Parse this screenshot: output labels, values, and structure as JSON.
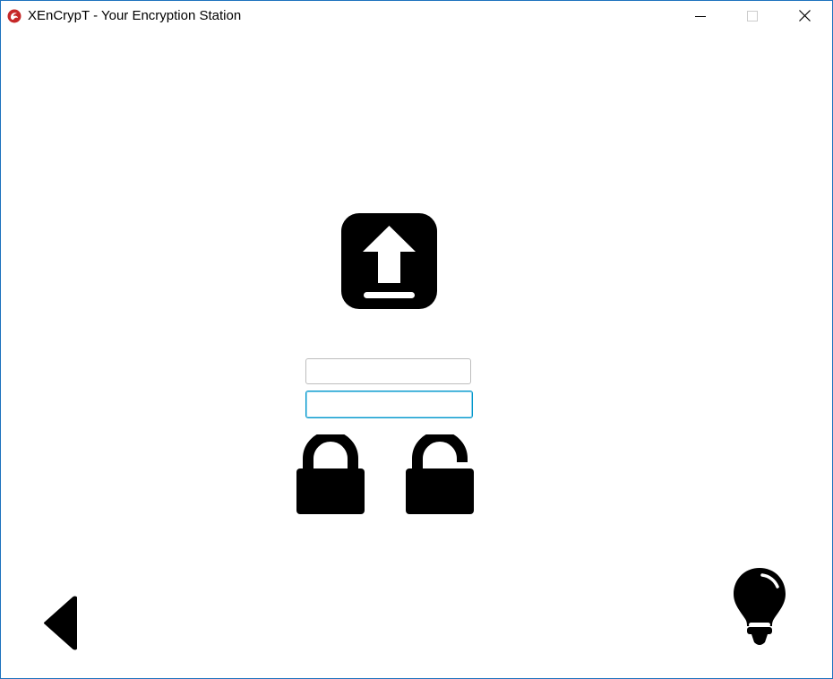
{
  "window": {
    "title": "XEnCrypT - Your Encryption Station",
    "app_icon": "xencrypt-logo-icon",
    "controls": {
      "minimize_icon": "minimize-icon",
      "maximize_icon": "maximize-icon",
      "close_icon": "close-icon"
    },
    "border_color": "#1e73be"
  },
  "main": {
    "upload_icon": "upload-icon",
    "fields": [
      {
        "value": "",
        "placeholder": ""
      },
      {
        "value": "",
        "placeholder": ""
      }
    ],
    "encrypt_icon": "lock-closed-icon",
    "decrypt_icon": "lock-open-icon"
  },
  "footer": {
    "back_icon": "back-arrow-icon",
    "hint_icon": "lightbulb-icon"
  },
  "colors": {
    "icon": "#000000",
    "focus_border": "#0096c9"
  }
}
